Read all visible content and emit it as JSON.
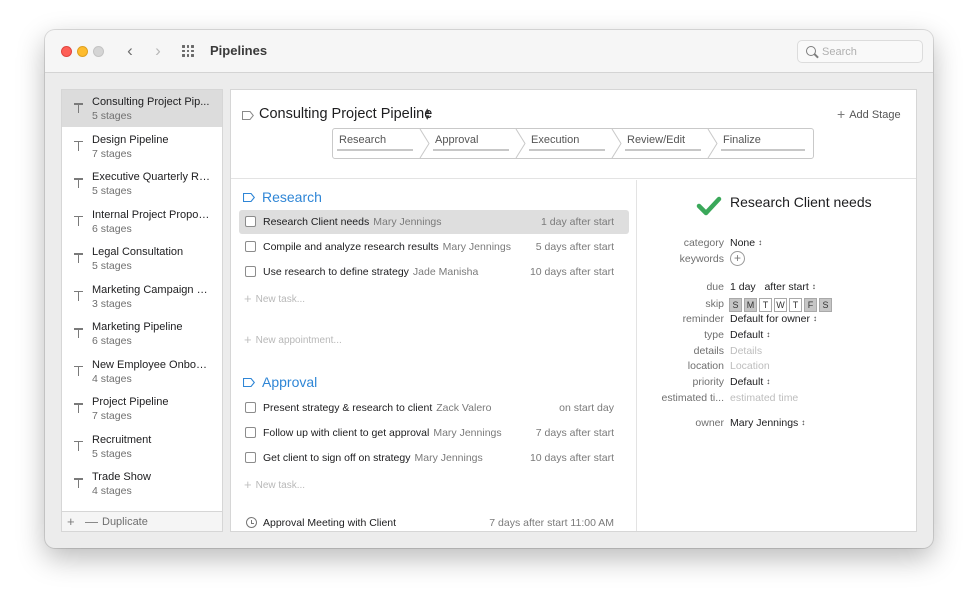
{
  "window": {
    "title": "Pipelines"
  },
  "search": {
    "placeholder": "Search"
  },
  "sidebar": {
    "items": [
      {
        "name": "Consulting Project Pip...",
        "stages": "5 stages",
        "selected": true
      },
      {
        "name": "Design Pipeline",
        "stages": "7 stages"
      },
      {
        "name": "Executive Quarterly Re...",
        "stages": "5 stages"
      },
      {
        "name": "Internal Project Proposal",
        "stages": "6 stages"
      },
      {
        "name": "Legal Consultation",
        "stages": "5 stages"
      },
      {
        "name": "Marketing Campaign R...",
        "stages": "3 stages"
      },
      {
        "name": "Marketing Pipeline",
        "stages": "6 stages"
      },
      {
        "name": "New Employee Onboar...",
        "stages": "4 stages"
      },
      {
        "name": "Project Pipeline",
        "stages": "7 stages"
      },
      {
        "name": "Recruitment",
        "stages": "5 stages"
      },
      {
        "name": "Trade Show",
        "stages": "4 stages"
      }
    ],
    "footer": {
      "add": "+",
      "remove": "—",
      "duplicate": "Duplicate"
    }
  },
  "pipeline": {
    "title": "Consulting Project Pipeline",
    "add_stage": "Add Stage",
    "stages": [
      "Research",
      "Approval",
      "Execution",
      "Review/Edit",
      "Finalize"
    ]
  },
  "sections": [
    {
      "title": "Research",
      "tasks": [
        {
          "title": "Research Client needs",
          "owner": "Mary Jennings",
          "when": "1 day after start",
          "selected": true
        },
        {
          "title": "Compile and analyze research results",
          "owner": "Mary Jennings",
          "when": "5 days after start"
        },
        {
          "title": "Use research to define strategy",
          "owner": "Jade Manisha",
          "when": "10 days after start"
        }
      ],
      "new_task": "New task...",
      "new_appointment": "New appointment..."
    },
    {
      "title": "Approval",
      "tasks": [
        {
          "title": "Present strategy & research to client",
          "owner": "Zack Valero",
          "when": "on start day"
        },
        {
          "title": "Follow up with client to get approval",
          "owner": "Mary Jennings",
          "when": "7 days after start"
        },
        {
          "title": "Get client to sign off on strategy",
          "owner": "Mary Jennings",
          "when": "10 days after start"
        }
      ],
      "new_task": "New task...",
      "appointments": [
        {
          "title": "Approval Meeting with Client",
          "when": "7 days after start 11:00 AM"
        }
      ]
    }
  ],
  "detail": {
    "title": "Research Client needs",
    "fields": {
      "category": {
        "label": "category",
        "value": "None"
      },
      "keywords": {
        "label": "keywords"
      },
      "due": {
        "label": "due",
        "amount": "1 day",
        "relation": "after start"
      },
      "skip": {
        "label": "skip",
        "days": [
          "S",
          "M",
          "T",
          "W",
          "T",
          "F",
          "S"
        ],
        "skipped": [
          true,
          true,
          false,
          false,
          false,
          true,
          true
        ]
      },
      "reminder": {
        "label": "reminder",
        "value": "Default for owner"
      },
      "type": {
        "label": "type",
        "value": "Default"
      },
      "details": {
        "label": "details",
        "placeholder": "Details"
      },
      "location": {
        "label": "location",
        "placeholder": "Location"
      },
      "priority": {
        "label": "priority",
        "value": "Default"
      },
      "estimated_time": {
        "label": "estimated ti...",
        "placeholder": "estimated time"
      },
      "owner": {
        "label": "owner",
        "value": "Mary Jennings"
      }
    }
  },
  "colors": {
    "accent": "#2f86d6",
    "check": "#3aa85a",
    "close": "#fe5f57",
    "minimize": "#febc2e"
  }
}
